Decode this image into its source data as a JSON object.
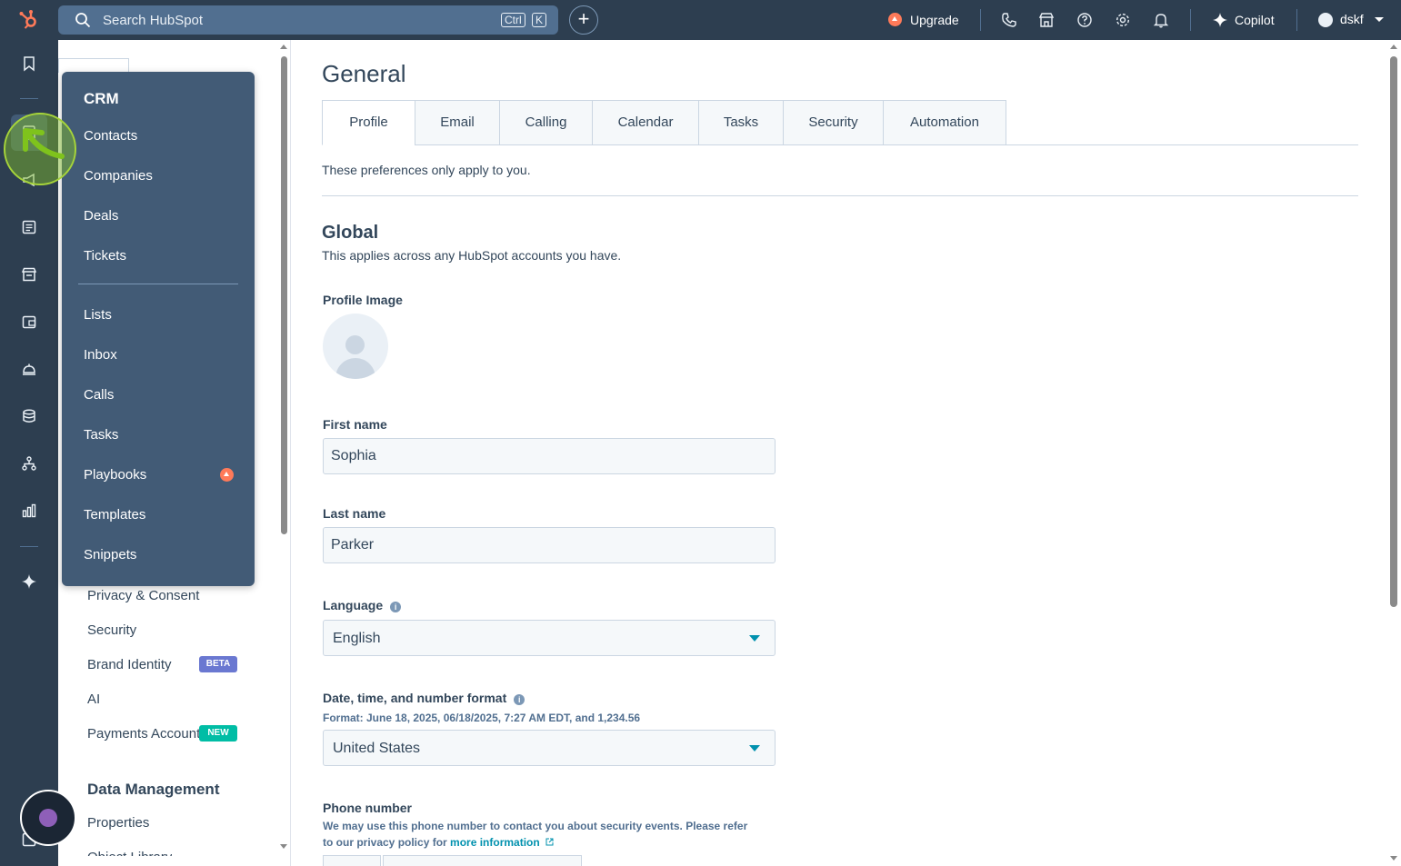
{
  "topbar": {
    "search_placeholder": "Search HubSpot",
    "shortcut_keys": [
      "Ctrl",
      "K"
    ],
    "upgrade_label": "Upgrade",
    "copilot_label": "Copilot",
    "account_name": "dskf",
    "icons": [
      "phone-icon",
      "marketplace-icon",
      "help-icon",
      "settings-gear-icon",
      "notifications-bell-icon"
    ]
  },
  "rail": {
    "icons": [
      "bookmark-icon",
      "crm-contacts-icon",
      "marketing-megaphone-icon",
      "content-icon",
      "commerce-icon",
      "sales-icon",
      "service-icon",
      "data-management-icon",
      "automation-icon",
      "reporting-icon",
      "breeze-ai-icon"
    ]
  },
  "flyout": {
    "heading": "CRM",
    "items": [
      "Contacts",
      "Companies",
      "Deals",
      "Tickets",
      "Lists",
      "Inbox",
      "Calls",
      "Tasks",
      "Playbooks",
      "Templates",
      "Snippets"
    ]
  },
  "settings_nav": {
    "items": [
      "Privacy & Consent",
      "Security",
      "Brand Identity",
      "AI",
      "Payments Account"
    ],
    "beta_badge": "BETA",
    "new_badge": "NEW",
    "section_heading": "Data Management",
    "section_items": [
      "Properties",
      "Object Library"
    ]
  },
  "main": {
    "title": "General",
    "tabs": [
      "Profile",
      "Email",
      "Calling",
      "Calendar",
      "Tasks",
      "Security",
      "Automation"
    ],
    "active_tab": "Profile",
    "preferences_note": "These preferences only apply to you.",
    "global_title": "Global",
    "global_desc": "This applies across any HubSpot accounts you have.",
    "profile_image_label": "Profile Image",
    "first_name_label": "First name",
    "first_name_value": "Sophia",
    "last_name_label": "Last name",
    "last_name_value": "Parker",
    "language_label": "Language",
    "language_value": "English",
    "format_label": "Date, time, and number format",
    "format_example": "Format: June 18, 2025, 06/18/2025, 7:27 AM EDT, and 1,234.56",
    "format_value": "United States",
    "phone_label": "Phone number",
    "phone_note_line1": "We may use this phone number to contact you about security events. Please refer",
    "phone_note_line2": "to our privacy policy for",
    "phone_link": "more information"
  },
  "colors": {
    "nav_dark": "#2d3e50",
    "flyout_bg": "#425b76",
    "accent_teal": "#0091ae",
    "upgrade_orange": "#ff7a59",
    "beta_badge": "#6a78d1",
    "new_badge": "#00bda5"
  }
}
